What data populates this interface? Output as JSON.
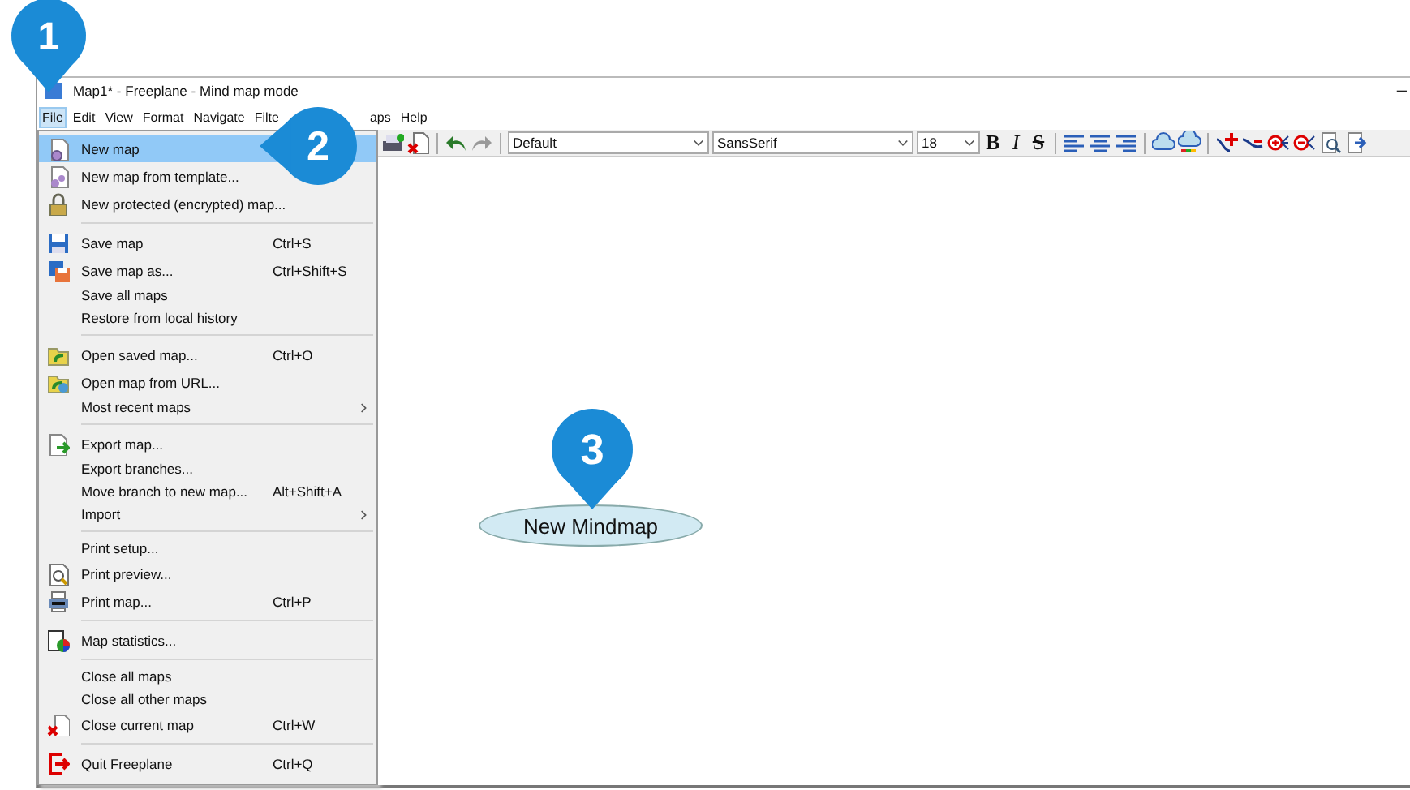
{
  "window": {
    "title": "Map1* - Freeplane - Mind map mode",
    "controls": [
      "–"
    ]
  },
  "menu_bar": [
    {
      "label": "File",
      "selected": true
    },
    {
      "label": "Edit",
      "selected": false
    },
    {
      "label": "View",
      "selected": false
    },
    {
      "label": "Format",
      "selected": false
    },
    {
      "label": "Navigate",
      "selected": false
    },
    {
      "label": "Filte",
      "selected": false
    },
    {
      "label": "aps",
      "selected": false
    },
    {
      "label": "Help",
      "selected": false
    }
  ],
  "toolbar": [
    {
      "kind": "icon"
    },
    {
      "kind": "icon"
    },
    {
      "kind": "sep"
    },
    {
      "kind": "icon"
    },
    {
      "kind": "icon"
    },
    {
      "kind": "sep"
    },
    {
      "kind": "combo",
      "value": "Default"
    },
    {
      "kind": "combo",
      "value": "SansSerif"
    },
    {
      "kind": "combo",
      "value": "18"
    },
    {
      "kind": "glyph",
      "text": "B"
    },
    {
      "kind": "glyph",
      "text": "I"
    },
    {
      "kind": "glyph",
      "text": "S"
    },
    {
      "kind": "sep"
    },
    {
      "kind": "icon"
    },
    {
      "kind": "icon"
    },
    {
      "kind": "icon"
    },
    {
      "kind": "sep"
    },
    {
      "kind": "icon"
    },
    {
      "kind": "icon"
    },
    {
      "kind": "sep"
    },
    {
      "kind": "icon"
    },
    {
      "kind": "icon"
    },
    {
      "kind": "icon"
    },
    {
      "kind": "icon"
    },
    {
      "kind": "icon"
    },
    {
      "kind": "icon"
    }
  ],
  "file_menu": [
    {
      "kind": "icon_item",
      "label": "New map",
      "selected": true
    },
    {
      "kind": "icon_item",
      "label": "New map from template...",
      "selected": false
    },
    {
      "kind": "icon_item",
      "label": "New protected (encrypted) map...",
      "selected": false
    },
    {
      "kind": "separator"
    },
    {
      "kind": "icon_item",
      "label": "Save map",
      "shortcut": "Ctrl+S",
      "selected": false
    },
    {
      "kind": "icon_item",
      "label": "Save map as...",
      "shortcut": "Ctrl+Shift+S",
      "selected": false
    },
    {
      "kind": "item",
      "label": "Save all maps",
      "selected": false
    },
    {
      "kind": "item",
      "label": "Restore from local history",
      "selected": false
    },
    {
      "kind": "separator"
    },
    {
      "kind": "icon_item",
      "label": "Open saved map...",
      "shortcut": "Ctrl+O",
      "selected": false
    },
    {
      "kind": "icon_item",
      "label": "Open map from URL...",
      "selected": false
    },
    {
      "kind": "item",
      "label": "Most recent maps",
      "submenu": true,
      "selected": false
    },
    {
      "kind": "separator"
    },
    {
      "kind": "icon_item",
      "label": "Export map...",
      "selected": false
    },
    {
      "kind": "item",
      "label": "Export branches...",
      "selected": false
    },
    {
      "kind": "item",
      "label": "Move branch to new map...",
      "shortcut": "Alt+Shift+A",
      "selected": false
    },
    {
      "kind": "item",
      "label": "Import",
      "submenu": true,
      "selected": false
    },
    {
      "kind": "separator"
    },
    {
      "kind": "item",
      "label": "Print setup...",
      "selected": false
    },
    {
      "kind": "icon_item",
      "label": "Print preview...",
      "selected": false
    },
    {
      "kind": "icon_item",
      "label": "Print map...",
      "shortcut": "Ctrl+P",
      "selected": false
    },
    {
      "kind": "separator"
    },
    {
      "kind": "icon_item",
      "label": "Map statistics...",
      "selected": false
    },
    {
      "kind": "separator"
    },
    {
      "kind": "item",
      "label": "Close all maps",
      "selected": false
    },
    {
      "kind": "item",
      "label": "Close all other maps",
      "selected": false
    },
    {
      "kind": "icon_item",
      "label": "Close current map",
      "shortcut": "Ctrl+W",
      "selected": false
    },
    {
      "kind": "separator"
    },
    {
      "kind": "icon_item",
      "label": "Quit Freeplane",
      "shortcut": "Ctrl+Q",
      "selected": false
    }
  ],
  "map": {
    "root_node": "New Mindmap"
  },
  "callouts": [
    {
      "number": "1"
    },
    {
      "number": "2"
    },
    {
      "number": "3"
    }
  ]
}
